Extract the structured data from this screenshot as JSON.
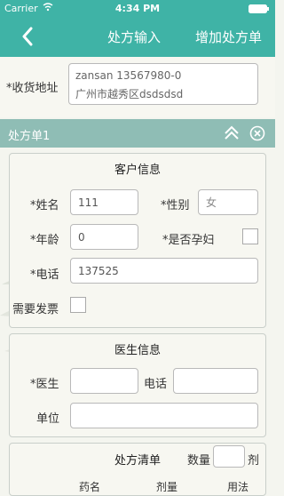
{
  "status": {
    "carrier": "Carrier",
    "time": "4:34 PM"
  },
  "nav": {
    "title": "处方输入",
    "right_action": "增加处方单"
  },
  "address": {
    "label": "*收货地址",
    "line1": "zansan  13567980-0",
    "line2": "广州市越秀区dsdsdsd"
  },
  "prescription": {
    "title": "处方单1"
  },
  "customer": {
    "section_title": "客户信息",
    "name_label": "*姓名",
    "name_value": "111",
    "gender_label": "*性别",
    "gender_value": "女",
    "age_label": "*年龄",
    "age_value": "0",
    "pregnant_label": "*是否孕妇",
    "phone_label": "*电话",
    "phone_value": "137525",
    "invoice_label": "需要发票"
  },
  "doctor": {
    "section_title": "医生信息",
    "doctor_label": "*医生",
    "phone_label": "电话",
    "unit_label": "单位"
  },
  "list": {
    "section_title": "处方清单",
    "qty_label": "数量",
    "qty_unit": "剂",
    "columns": [
      "药名",
      "剂量",
      "用法"
    ]
  },
  "colors": {
    "accent": "#3fb3a6",
    "header_band": "#8fbdb5"
  }
}
